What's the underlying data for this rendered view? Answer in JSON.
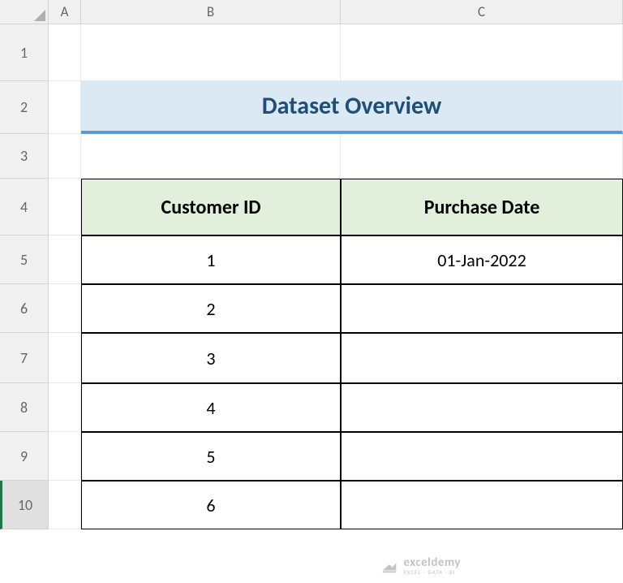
{
  "columns": [
    "A",
    "B",
    "C"
  ],
  "rows": [
    "1",
    "2",
    "3",
    "4",
    "5",
    "6",
    "7",
    "8",
    "9",
    "10"
  ],
  "title": "Dataset Overview",
  "table": {
    "headers": {
      "col_b": "Customer ID",
      "col_c": "Purchase Date"
    },
    "data": [
      {
        "id": "1",
        "date": "01-Jan-2022"
      },
      {
        "id": "2",
        "date": ""
      },
      {
        "id": "3",
        "date": ""
      },
      {
        "id": "4",
        "date": ""
      },
      {
        "id": "5",
        "date": ""
      },
      {
        "id": "6",
        "date": ""
      }
    ]
  },
  "watermark": {
    "brand": "exceldemy",
    "tag": "EXCEL · DATA · BI"
  }
}
